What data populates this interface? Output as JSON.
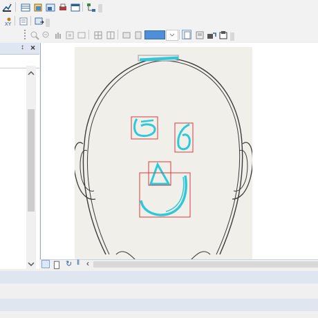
{
  "toolbar": {
    "row1_icons": [
      "select-features-icon",
      "attribute-table-icon",
      "layer-properties-icon",
      "layout-view-icon",
      "print-icon",
      "window-icon",
      "model-icon"
    ],
    "row2_icons": [
      "xy-coordinate-icon",
      "layer-list-icon",
      "export-icon"
    ],
    "row3_icons": [
      "zoom-in-page-icon",
      "zoom-out-page-icon",
      "pan-page-icon",
      "full-page-icon",
      "fixed-zoom-icon",
      "previous-extent-icon",
      "next-extent-icon",
      "zoom-percent-icon",
      "toggle-draft-icon",
      "focus-data-frame-icon",
      "change-layout-icon",
      "data-driven-pages-icon"
    ],
    "zoom_field": ""
  },
  "left_panel": {
    "pin_glyph": "↕",
    "close_glyph": "×"
  },
  "view_controls": {
    "refresh_glyph": "↻",
    "pause_glyph": "‖",
    "scroll_left_glyph": "‹"
  },
  "colors": {
    "face_outline": "#3a3a3a",
    "feature_stroke": "#2ec8d8",
    "bbox_stroke": "#d83a3a",
    "page_bg": "#f0efe9"
  }
}
